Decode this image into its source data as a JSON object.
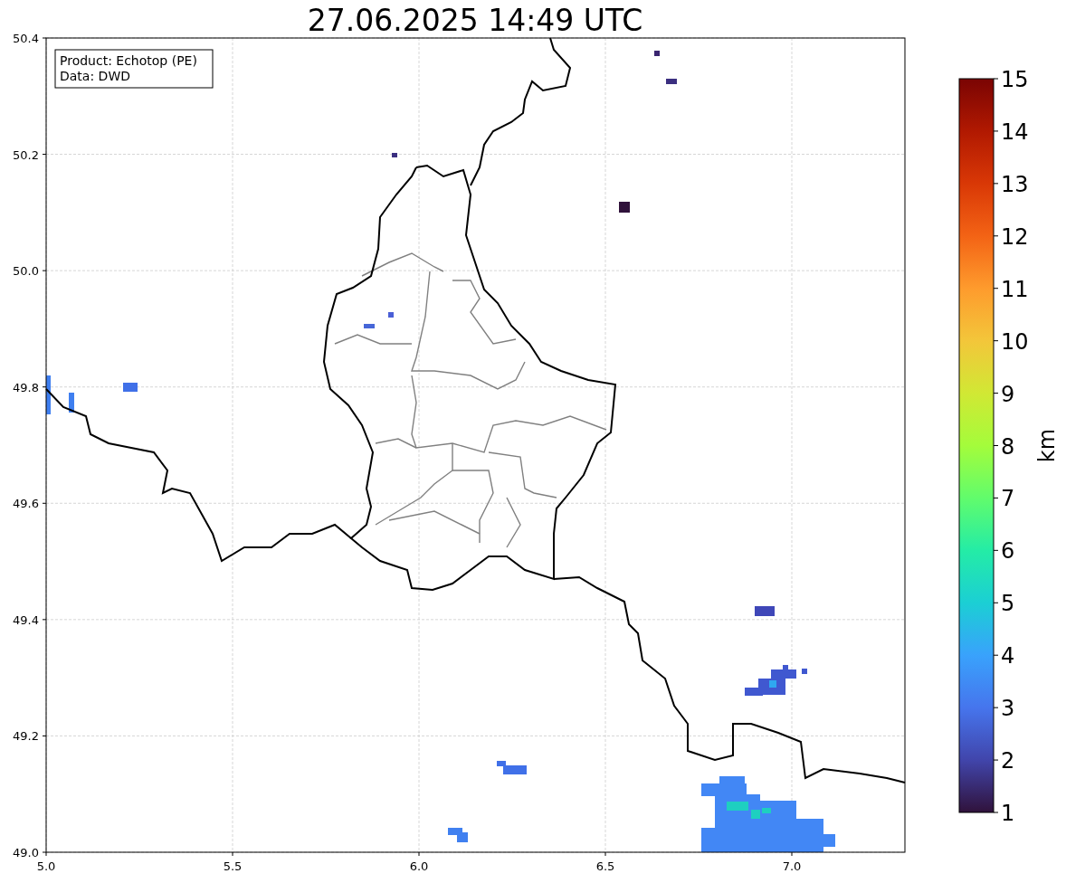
{
  "title": "27.06.2025 14:49 UTC",
  "info_box": [
    "Product: Echotop (PE)",
    "Data: DWD"
  ],
  "x_ticks": [
    "5.0",
    "5.5",
    "6.0",
    "6.5",
    "7.0"
  ],
  "y_ticks": [
    "50.4",
    "50.2",
    "50.0",
    "49.8",
    "49.6",
    "49.4",
    "49.2",
    "49.0"
  ],
  "colorbar": {
    "label": "km",
    "ticks": [
      "15",
      "14",
      "13",
      "12",
      "11",
      "10",
      "9",
      "8",
      "7",
      "6",
      "5",
      "4",
      "3",
      "2",
      "1"
    ]
  }
}
